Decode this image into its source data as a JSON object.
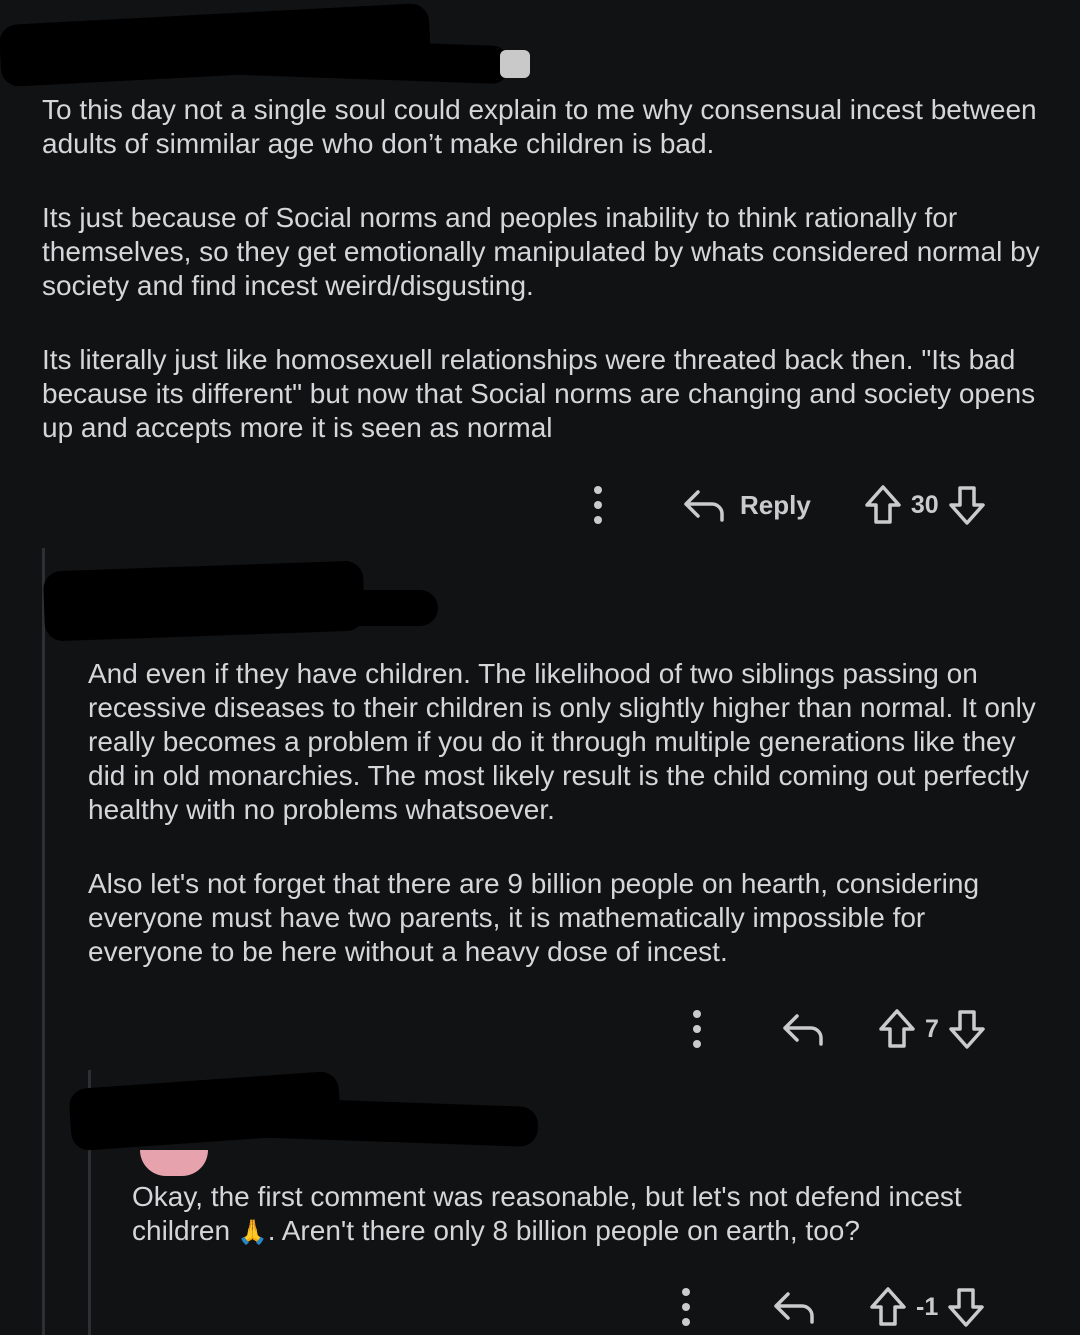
{
  "comments": [
    {
      "paragraphs": [
        "To this day not a single soul could explain to me why consensual incest between adults of simmilar age who don’t make children is bad.",
        "Its just because of Social norms and peoples inability to think rationally for themselves, so they get emotionally manipulated by whats considered normal by society and find incest weird/disgusting.",
        "Its literally just like homosexuell relationships were threated back then. \"Its bad because its different\" but now that Social norms are changing and society opens up and accepts more it is seen as normal"
      ],
      "reply_label": "Reply",
      "score": "30"
    },
    {
      "paragraphs": [
        "And even if they have children. The likelihood of two siblings passing on recessive diseases to their children is only slightly higher than normal. It only really becomes a problem if you do it through multiple generations like they did in old monarchies. The most likely result is the child coming out perfectly healthy with no problems whatsoever.",
        "Also let's not forget that there are 9 billion people on hearth, considering everyone must have two parents, it is mathematically impossible for everyone to be here without a heavy dose of incest."
      ],
      "score": "7"
    },
    {
      "text_before_emoji": "Okay, the first comment was reasonable, but let's not defend incest children ",
      "emoji": "🙏",
      "text_after_emoji": ". Aren't there only 8 billion people on earth, too?",
      "score": "-1"
    }
  ],
  "icons": [
    "more-options-icon",
    "reply-arrow-icon",
    "upvote-arrow-icon",
    "downvote-arrow-icon",
    "pray-emoji"
  ],
  "colors": {
    "background": "#111214",
    "text": "#d4d6d8",
    "icon": "#b9bcbf",
    "redaction": "#000000"
  }
}
